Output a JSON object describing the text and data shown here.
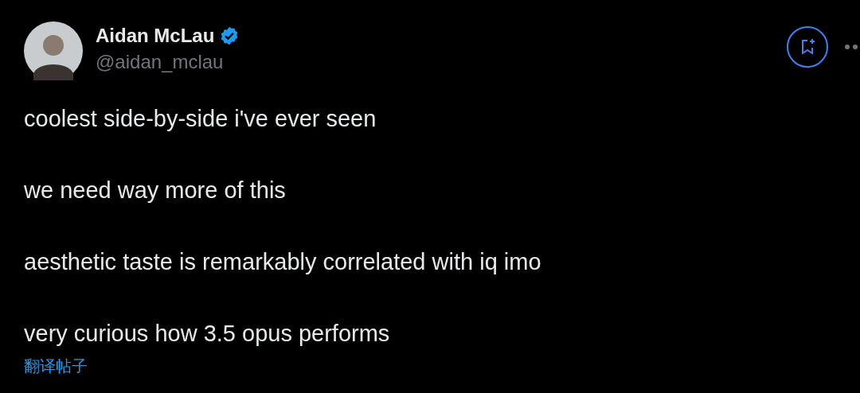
{
  "author": {
    "name": "Aidan McLau",
    "handle": "@aidan_mclau",
    "verified": true
  },
  "paragraphs": [
    "coolest side-by-side i've ever seen",
    "we need way more of this",
    "aesthetic taste is remarkably correlated with iq imo",
    "very curious how 3.5 opus performs"
  ],
  "translate_link": "翻译帖子"
}
